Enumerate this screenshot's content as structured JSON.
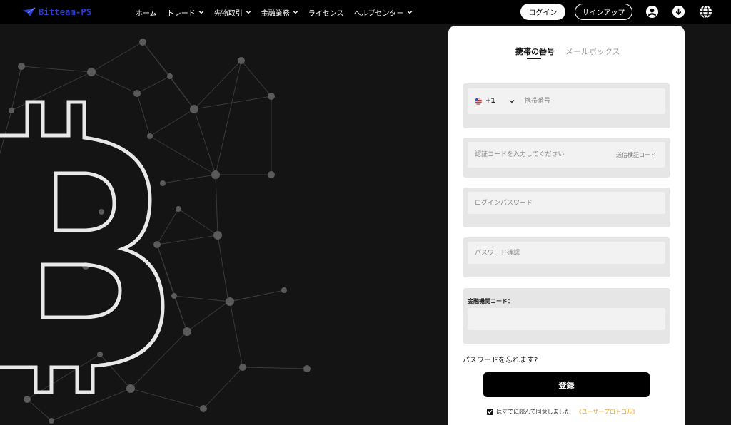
{
  "brand": {
    "name": "Bitteam-PS",
    "accent": "#2b3fd6"
  },
  "nav": [
    {
      "label": "ホーム",
      "dropdown": false
    },
    {
      "label": "トレード",
      "dropdown": true
    },
    {
      "label": "先物取引",
      "dropdown": true
    },
    {
      "label": "金融業務",
      "dropdown": true
    },
    {
      "label": "ライセンス",
      "dropdown": false
    },
    {
      "label": "ヘルプセンター",
      "dropdown": true
    }
  ],
  "header": {
    "login_label": "ログイン",
    "signup_label": "サインアップ",
    "icons": [
      "user-icon",
      "download-icon",
      "globe-icon"
    ]
  },
  "form": {
    "tabs": {
      "phone": "携帯の番号",
      "email": "メールボックス"
    },
    "country_code": "+1",
    "phone_placeholder": "携帯番号",
    "code_placeholder": "認証コードを入力してください",
    "send_code_label": "送信検証コード",
    "password_placeholder": "ログインパスワード",
    "confirm_placeholder": "パスワード確認",
    "institution_label": "金融機関コード：",
    "institution_value": "",
    "forgot_label": "パスワードを忘れます?",
    "register_label": "登録",
    "agree_text": "はすでに読んで同意しました",
    "protocol_label": "《ユーザープロトコル》",
    "agree_checked": true
  },
  "colors": {
    "protocol": "#e8a020",
    "register_bg": "#000000"
  }
}
